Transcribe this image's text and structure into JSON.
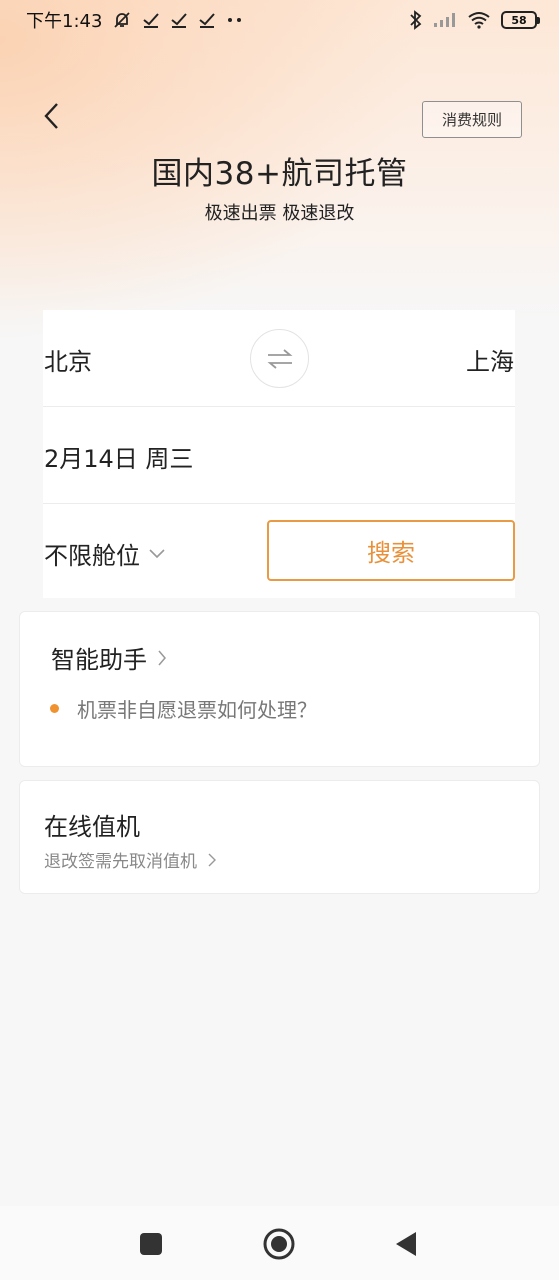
{
  "status_bar": {
    "time": "下午1:43",
    "battery": "58"
  },
  "header": {
    "title": "国内38+航司托管",
    "subtitle": "极速出票 极速退改",
    "rules_button": "消费规则"
  },
  "search": {
    "from_city": "北京",
    "to_city": "上海",
    "date": "2月14日 周三",
    "cabin": "不限舱位",
    "search_button": "搜索"
  },
  "assistant": {
    "title": "智能助手",
    "faq": "机票非自愿退票如何处理？"
  },
  "checkin": {
    "title": "在线值机",
    "subtitle": "退改签需先取消值机"
  },
  "colors": {
    "accent": "#e8913a",
    "dot": "#f0922f",
    "header_gradient": "#fbd3b4"
  }
}
